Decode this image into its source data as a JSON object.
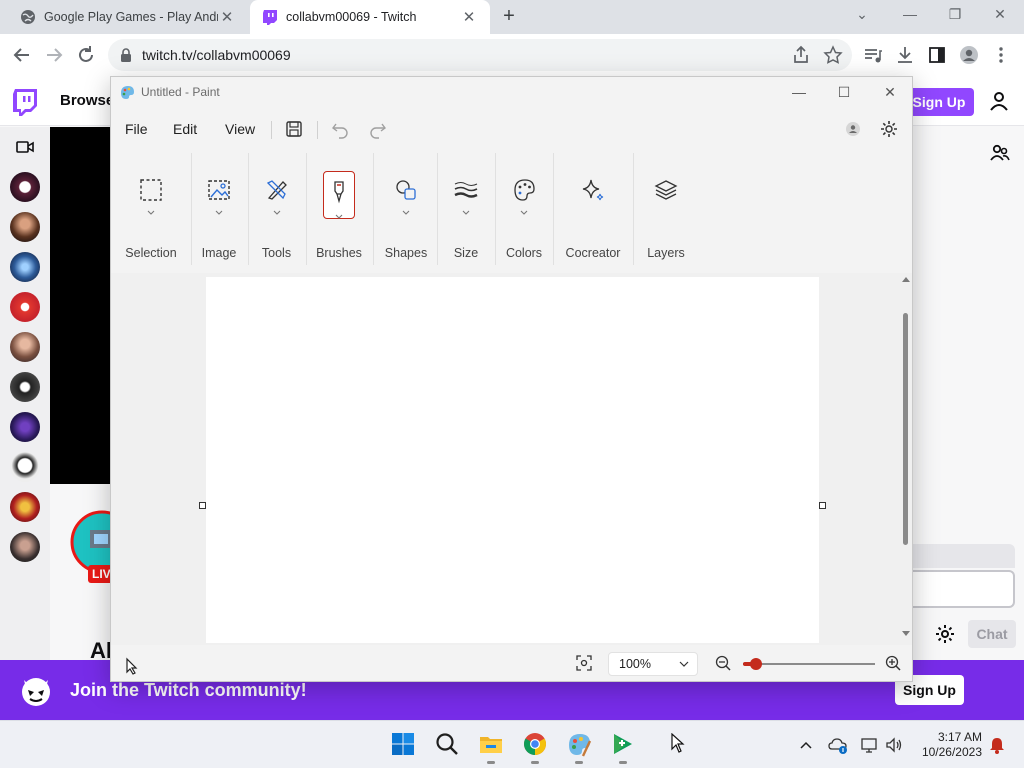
{
  "browser": {
    "tabs": [
      {
        "title": "Google Play Games - Play Andro",
        "active": false
      },
      {
        "title": "collabvm00069 - Twitch",
        "active": true
      }
    ],
    "new_tab": "+",
    "url": "twitch.tv/collabvm00069"
  },
  "twitch": {
    "browse": "Browse",
    "signup": "Sign Up",
    "live_badge": "LIV",
    "channel_partial": "Al",
    "chat_button": "Chat",
    "banner_text": "Join the Twitch community!",
    "banner_signup": "Sign Up",
    "colors": {
      "brand": "#9147ff",
      "banner": "#772ce8",
      "live": "#e91916"
    }
  },
  "paint": {
    "title": "Untitled - Paint",
    "menu": [
      "File",
      "Edit",
      "View"
    ],
    "ribbon": [
      {
        "label": "Selection",
        "icon": "selection-icon"
      },
      {
        "label": "Image",
        "icon": "image-icon"
      },
      {
        "label": "Tools",
        "icon": "tools-icon"
      },
      {
        "label": "Brushes",
        "icon": "brush-icon",
        "selected": true
      },
      {
        "label": "Shapes",
        "icon": "shapes-icon"
      },
      {
        "label": "Size",
        "icon": "size-icon"
      },
      {
        "label": "Colors",
        "icon": "palette-icon"
      },
      {
        "label": "Cocreator",
        "icon": "sparkle-icon"
      },
      {
        "label": "Layers",
        "icon": "layers-icon"
      }
    ],
    "zoom_value": "100%",
    "zoom_level": 0.1,
    "accent": "#c42b1c"
  },
  "taskbar": {
    "time": "3:17 AM",
    "date": "10/26/2023"
  }
}
